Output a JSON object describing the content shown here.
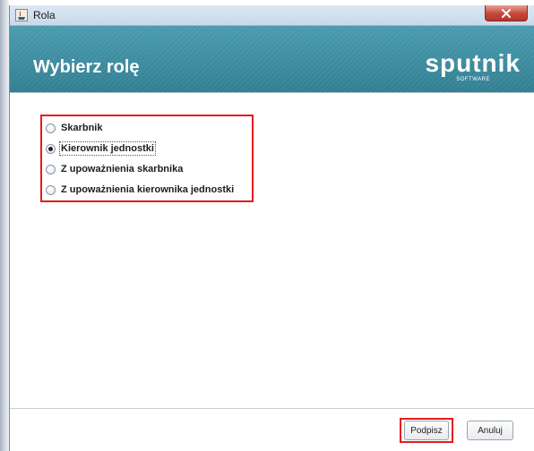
{
  "window": {
    "title": "Rola"
  },
  "banner": {
    "heading": "Wybierz rolę",
    "logo_text": "sputnik",
    "logo_subtext": "SOFTWARE"
  },
  "roles": {
    "options": [
      {
        "label": "Skarbnik",
        "selected": false
      },
      {
        "label": "Kierownik jednostki",
        "selected": true
      },
      {
        "label": "Z upoważnienia skarbnika",
        "selected": false
      },
      {
        "label": "Z upoważnienia kierownika jednostki",
        "selected": false
      }
    ]
  },
  "buttons": {
    "sign_label": "Podpisz",
    "cancel_label": "Anuluj"
  },
  "colors": {
    "banner": "#3f8fa3",
    "highlight": "#e8191d",
    "close_button": "#c6463a"
  },
  "icons": {
    "app": "java-app-icon",
    "close": "close-icon"
  }
}
